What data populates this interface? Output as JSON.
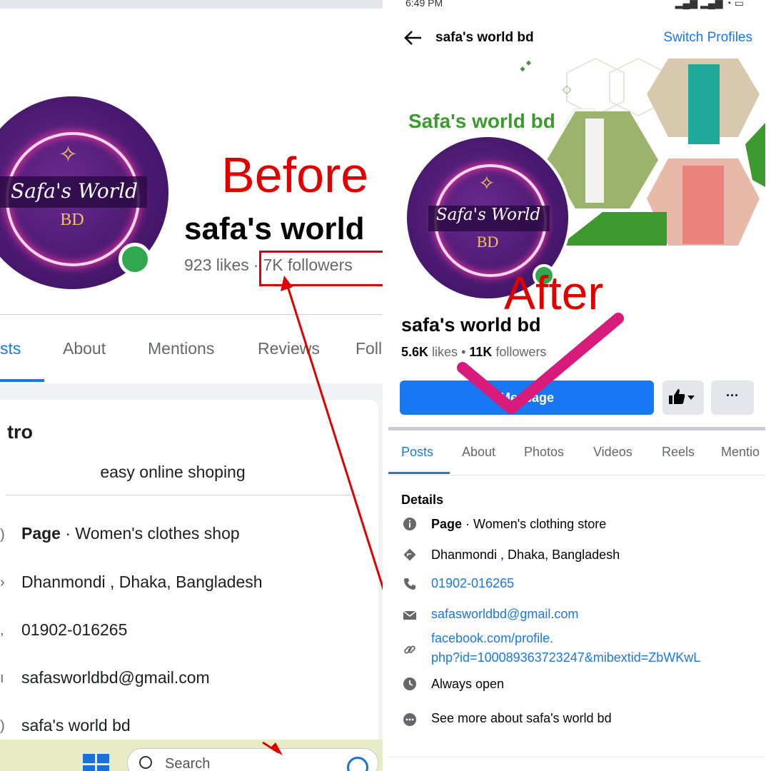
{
  "before": {
    "label": "Before",
    "page_name": "safa's world",
    "likes": "923 likes",
    "followers": "7K followers",
    "logo_script": "Safa's World",
    "logo_bd": "BD",
    "tabs": [
      "sts",
      "About",
      "Mentions",
      "Reviews",
      "Foll"
    ],
    "intro_title": "tro",
    "bio": "easy online shoping",
    "rows": [
      {
        "bold": "Page",
        "text": " · Women's clothes shop"
      },
      {
        "bold": "",
        "text": "Dhanmondi , Dhaka, Bangladesh"
      },
      {
        "bold": "",
        "text": "01902-016265"
      },
      {
        "bold": "",
        "text": "safasworldbd@gmail.com"
      },
      {
        "bold": "",
        "text": "safa's world bd"
      }
    ],
    "taskbar_search": "Search"
  },
  "after": {
    "label": "After",
    "status_time": "6:49 PM",
    "header_title": "safa's world bd",
    "switch_profiles": "Switch Profiles",
    "cover_title": "Safa's world bd",
    "logo_script": "Safa's World",
    "logo_bd": "BD",
    "page_name": "safa's world bd",
    "likes_count": "5.6K",
    "likes_word": " likes",
    "followers_count": "11K",
    "followers_word": " followers",
    "message_button": "Message",
    "more_button": "···",
    "tabs": [
      "Posts",
      "About",
      "Photos",
      "Videos",
      "Reels",
      "Mentio"
    ],
    "details_title": "Details",
    "details": {
      "category_bold": "Page",
      "category_text": " · Women's clothing store",
      "address": "Dhanmondi , Dhaka, Bangladesh",
      "phone": "01902-016265",
      "email": "safasworldbd@gmail.com",
      "website_line1": "facebook.com/profile.",
      "website_line2": "php?id=100089363723247&mibextid=ZbWKwL",
      "hours": "Always open",
      "see_more": "See more about safa's world bd"
    }
  },
  "colors": {
    "annotation_red": "#e10000",
    "checkmark_pink": "#d81b7a",
    "facebook_blue": "#1877f2",
    "cover_green": "#3c9a2e",
    "logo_purple": "#4a1a70"
  }
}
